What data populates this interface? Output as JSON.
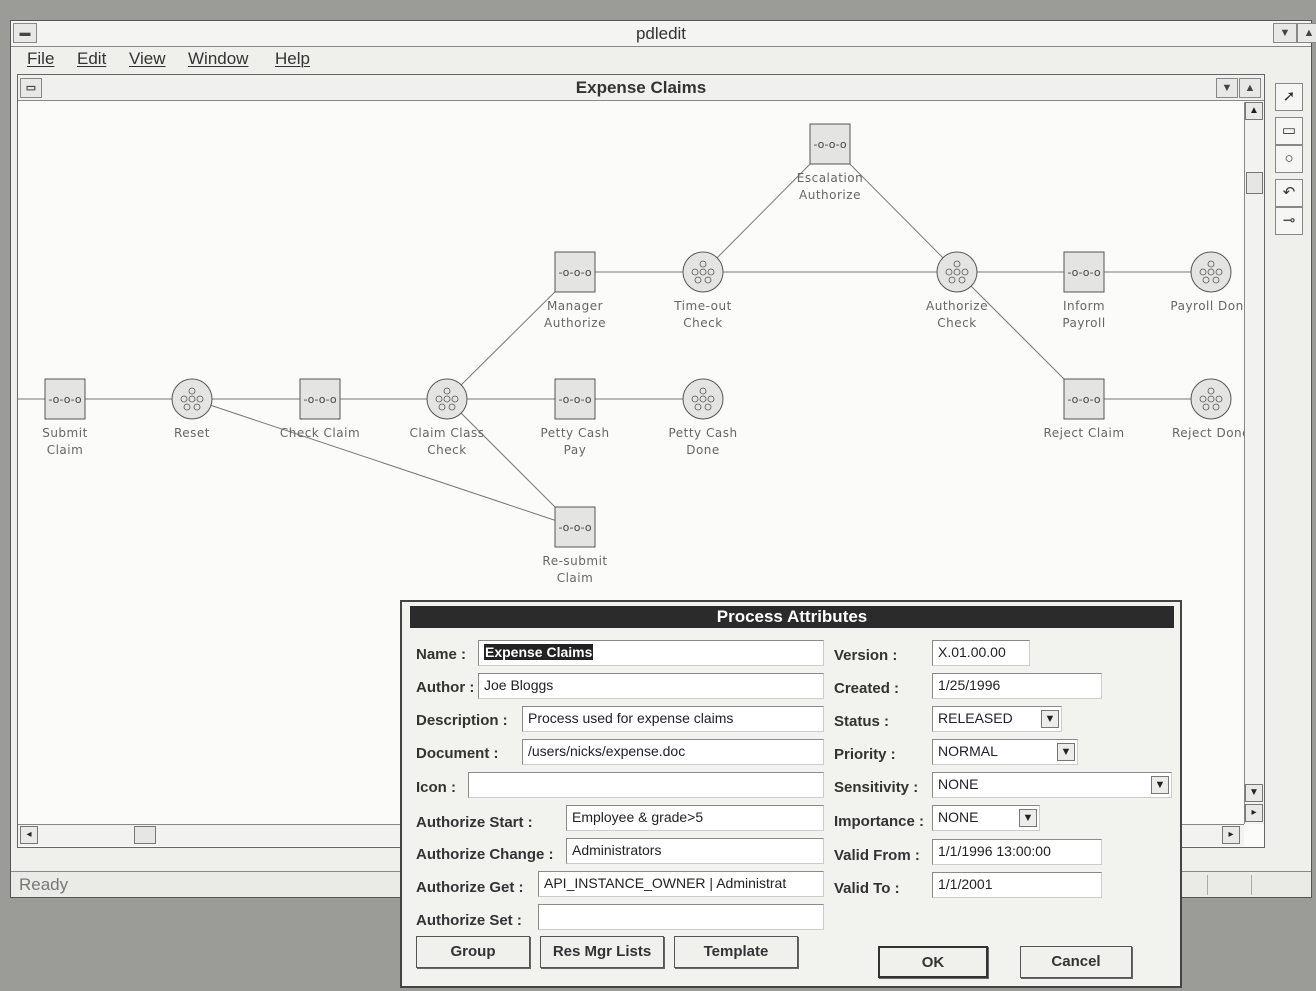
{
  "app": {
    "title": "pdledit",
    "menu": [
      "File",
      "Edit",
      "View",
      "Window",
      "Help"
    ],
    "status": "Ready"
  },
  "child_window": {
    "title": "Expense Claims"
  },
  "diagram": {
    "nodes": [
      {
        "id": "submit",
        "kind": "activity",
        "label": [
          "Submit",
          "Claim"
        ]
      },
      {
        "id": "reset",
        "kind": "route",
        "label": [
          "Reset"
        ]
      },
      {
        "id": "check",
        "kind": "activity",
        "label": [
          "Check Claim"
        ]
      },
      {
        "id": "classcheck",
        "kind": "route",
        "label": [
          "Claim Class",
          "Check"
        ]
      },
      {
        "id": "mgr",
        "kind": "activity",
        "label": [
          "Manager",
          "Authorize"
        ]
      },
      {
        "id": "timeout",
        "kind": "route",
        "label": [
          "Time-out",
          "Check"
        ]
      },
      {
        "id": "esc",
        "kind": "activity",
        "label": [
          "Escalation",
          "Authorize"
        ]
      },
      {
        "id": "authcheck",
        "kind": "route",
        "label": [
          "Authorize",
          "Check"
        ]
      },
      {
        "id": "inform",
        "kind": "activity",
        "label": [
          "Inform",
          "Payroll"
        ]
      },
      {
        "id": "paydone",
        "kind": "route",
        "label": [
          "Payroll Done"
        ]
      },
      {
        "id": "petty",
        "kind": "activity",
        "label": [
          "Petty Cash",
          "Pay"
        ]
      },
      {
        "id": "pettydone",
        "kind": "route",
        "label": [
          "Petty Cash",
          "Done"
        ]
      },
      {
        "id": "reject",
        "kind": "activity",
        "label": [
          "Reject Claim"
        ]
      },
      {
        "id": "rejdone",
        "kind": "route",
        "label": [
          "Reject Done"
        ]
      },
      {
        "id": "resubmit",
        "kind": "activity",
        "label": [
          "Re-submit",
          "Claim"
        ]
      }
    ],
    "edges": [
      [
        "submit",
        "reset"
      ],
      [
        "reset",
        "check"
      ],
      [
        "check",
        "classcheck"
      ],
      [
        "classcheck",
        "petty"
      ],
      [
        "petty",
        "pettydone"
      ],
      [
        "classcheck",
        "mgr"
      ],
      [
        "mgr",
        "timeout"
      ],
      [
        "timeout",
        "authcheck"
      ],
      [
        "timeout",
        "esc"
      ],
      [
        "esc",
        "authcheck"
      ],
      [
        "authcheck",
        "inform"
      ],
      [
        "inform",
        "paydone"
      ],
      [
        "authcheck",
        "reject"
      ],
      [
        "reject",
        "rejdone"
      ],
      [
        "classcheck",
        "resubmit"
      ],
      [
        "reset",
        "resubmit"
      ]
    ]
  },
  "dialog": {
    "title": "Process Attributes",
    "left_fields": [
      {
        "label": "Name :",
        "value": "Expense Claims",
        "selected": true
      },
      {
        "label": "Author :",
        "value": "Joe Bloggs"
      },
      {
        "label": "Description :",
        "value": "Process used for expense claims"
      },
      {
        "label": "Document :",
        "value": "/users/nicks/expense.doc"
      },
      {
        "label": "Icon :",
        "value": ""
      },
      {
        "label": "Authorize Start :",
        "value": "Employee & grade>5"
      },
      {
        "label": "Authorize Change :",
        "value": "Administrators"
      },
      {
        "label": "Authorize Get :",
        "value": "API_INSTANCE_OWNER | Administrat"
      },
      {
        "label": "Authorize Set :",
        "value": ""
      }
    ],
    "right_fields": [
      {
        "label": "Version :",
        "value": "X.01.00.00"
      },
      {
        "label": "Created :",
        "value": "1/25/1996"
      },
      {
        "label": "Status :",
        "value": "RELEASED",
        "dropdown": true
      },
      {
        "label": "Priority :",
        "value": "NORMAL",
        "dropdown": true
      },
      {
        "label": "Sensitivity :",
        "value": "NONE",
        "dropdown": true
      },
      {
        "label": "Importance :",
        "value": "NONE",
        "dropdown": true
      },
      {
        "label": "Valid From :",
        "value": "1/1/1996 13:00:00"
      },
      {
        "label": "Valid To :",
        "value": "1/1/2001"
      }
    ],
    "buttons": {
      "group": "Group",
      "res_mgr": "Res Mgr Lists",
      "template": "Template",
      "ok": "OK",
      "cancel": "Cancel"
    }
  }
}
